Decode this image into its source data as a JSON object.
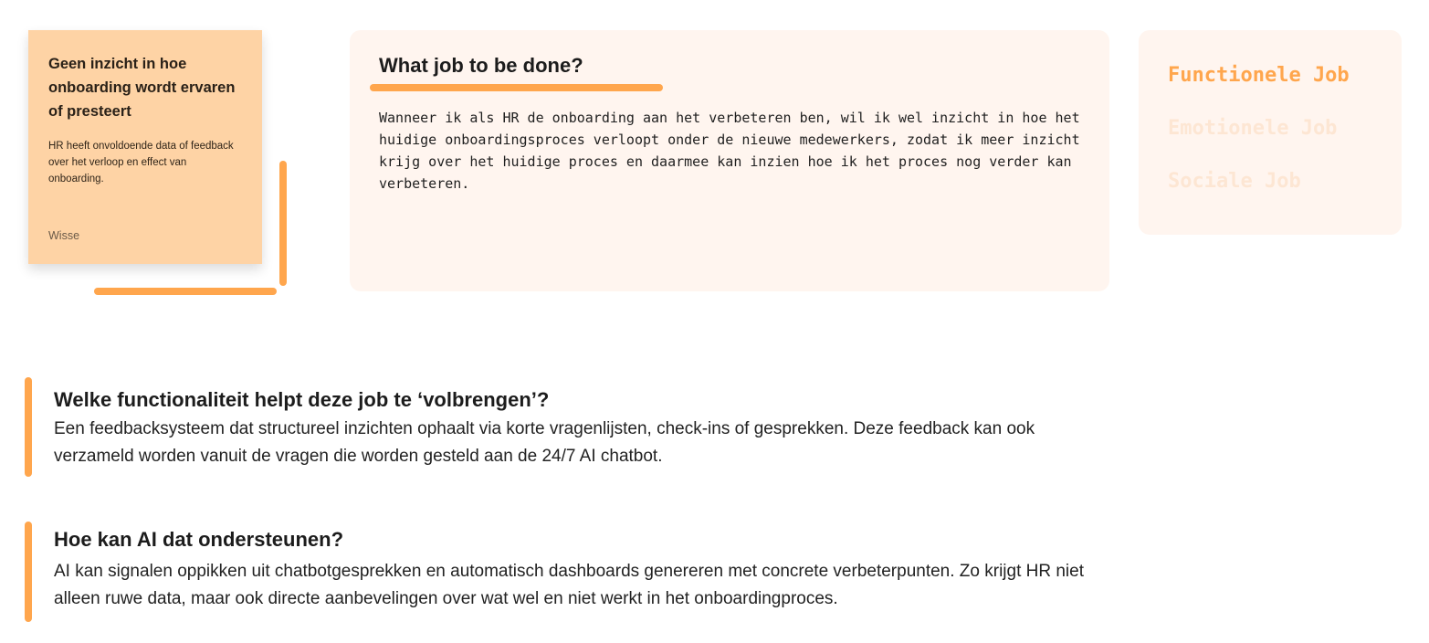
{
  "sticky_note": {
    "title": "Geen inzicht in hoe onboarding wordt ervaren of presteert",
    "body": "HR heeft onvoldoende data of feedback over het verloop en effect van onboarding.",
    "author": "Wisse"
  },
  "jtbd": {
    "title": "What job to be done?",
    "text": "Wanneer ik als HR de onboarding aan het verbeteren ben, wil ik wel inzicht in hoe het huidige onboardingsproces verloopt onder de nieuwe medewerkers, zodat ik meer inzicht krijg over het huidige proces en daarmee kan inzien hoe ik het proces nog verder kan verbeteren."
  },
  "job_types": {
    "items": [
      "Functionele Job",
      "Emotionele Job",
      "Sociale Job"
    ],
    "active": "Functionele Job"
  },
  "sections": [
    {
      "heading": "Welke functionaliteit helpt deze job te ‘volbrengen’?",
      "text": "Een feedbacksysteem dat structureel inzichten ophaalt via korte vragenlijsten, check-ins of gesprekken. Deze feedback kan ook verzameld worden vanuit de vragen die worden gesteld aan de 24/7 AI chatbot."
    },
    {
      "heading": "Hoe kan AI dat ondersteunen?",
      "text": "AI kan signalen oppikken uit chatbotgesprekken en automatisch dashboards genereren met concrete verbeterpunten. Zo krijgt HR niet alleen ruwe data, maar ook directe aanbevelingen over wat wel en niet werkt in het onboardingproces."
    }
  ],
  "colors": {
    "accent": "#ffa64d",
    "sticky": "#fed3a5",
    "panel": "#fff5ef",
    "muted_job": "#fde6d3"
  }
}
